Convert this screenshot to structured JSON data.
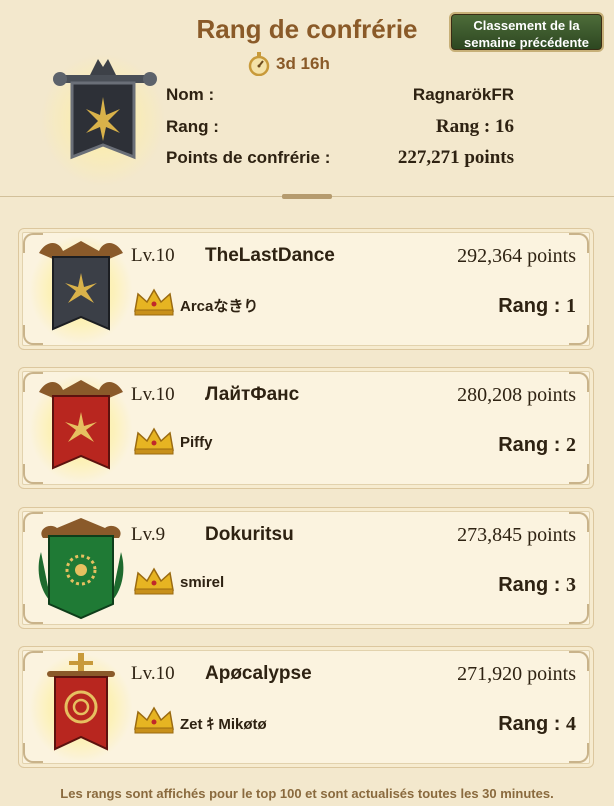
{
  "header": {
    "title": "Rang de confrérie",
    "prev_week_line1": "Classement de la",
    "prev_week_line2": "semaine précédente",
    "timer": "3d 16h"
  },
  "own_guild": {
    "emblem_icon": "guild-banner-icon",
    "name_label": "Nom :",
    "name_value": "RagnarökFR",
    "rank_label": "Rang :",
    "rank_value": "Rang : 16",
    "points_label": "Points de confrérie :",
    "points_value": "227,271 points"
  },
  "rankings": [
    {
      "level": "Lv.10",
      "name": "TheLastDance",
      "points": "292,364 points",
      "leader": "Arcaなきり",
      "rank_label": "Rang : ",
      "rank_num": "1",
      "banner_color": "#3b3f47",
      "emblem_icon": "winged-star-banner-icon"
    },
    {
      "level": "Lv.10",
      "name": "ЛайтФанс",
      "points": "280,208 points",
      "leader": "Piffy",
      "rank_label": "Rang : ",
      "rank_num": "2",
      "banner_color": "#b8261f",
      "emblem_icon": "winged-star-banner-icon"
    },
    {
      "level": "Lv.9",
      "name": "Dokuritsu",
      "points": "273,845 points",
      "leader": "smirel",
      "rank_label": "Rang : ",
      "rank_num": "3",
      "banner_color": "#1f7a35",
      "emblem_icon": "sun-wreath-banner-icon"
    },
    {
      "level": "Lv.10",
      "name": "Apøcalypse",
      "points": "271,920 points",
      "leader": "Zet ｷ Mikøtø",
      "rank_label": "Rang : ",
      "rank_num": "4",
      "banner_color": "#b8261f",
      "emblem_icon": "sword-seal-banner-icon"
    }
  ],
  "footer": "Les rangs sont affichés pour le top 100 et sont actualisés toutes les 30 minutes.",
  "colors": {
    "background": "#f3e8cd",
    "title": "#8a5a28",
    "button": "#3f5a2e",
    "text": "#2e2212"
  }
}
